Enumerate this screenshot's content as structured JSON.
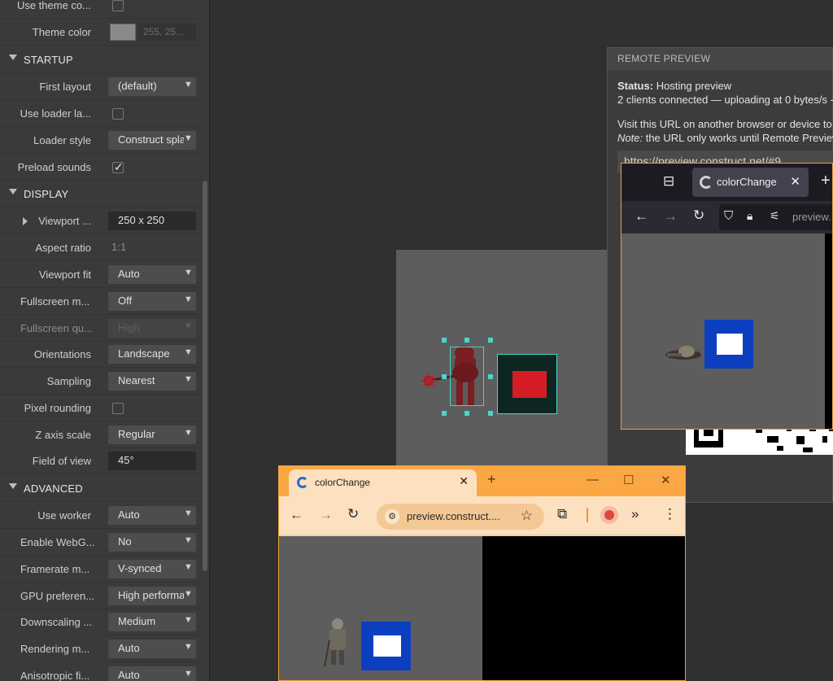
{
  "properties": {
    "rows_top": [
      {
        "label": "Use theme co...",
        "kind": "checkbox",
        "checked": false
      },
      {
        "label": "Theme color",
        "kind": "color",
        "value": "255, 25..."
      }
    ],
    "startup": {
      "title": "STARTUP",
      "first_layout": {
        "label": "First layout",
        "value": "(default)"
      },
      "use_loader": {
        "label": "Use loader la...",
        "checked": false
      },
      "loader_style": {
        "label": "Loader style",
        "value": "Construct spla"
      },
      "preload_sounds": {
        "label": "Preload sounds",
        "checked": true
      }
    },
    "display": {
      "title": "DISPLAY",
      "viewport_size": {
        "label": "Viewport ...",
        "value": "250 x 250"
      },
      "aspect_ratio": {
        "label": "Aspect ratio",
        "value": "1:1"
      },
      "viewport_fit": {
        "label": "Viewport fit",
        "value": "Auto"
      },
      "fullscreen_mode": {
        "label": "Fullscreen m...",
        "value": "Off"
      },
      "fullscreen_quality": {
        "label": "Fullscreen qu...",
        "value": "High"
      },
      "orientations": {
        "label": "Orientations",
        "value": "Landscape"
      },
      "sampling": {
        "label": "Sampling",
        "value": "Nearest"
      },
      "pixel_rounding": {
        "label": "Pixel rounding",
        "checked": false
      },
      "z_axis_scale": {
        "label": "Z axis scale",
        "value": "Regular"
      },
      "field_of_view": {
        "label": "Field of view",
        "value": "45°"
      }
    },
    "advanced": {
      "title": "ADVANCED",
      "use_worker": {
        "label": "Use worker",
        "value": "Auto"
      },
      "enable_webgpu": {
        "label": "Enable WebG...",
        "value": "No"
      },
      "framerate_mode": {
        "label": "Framerate m...",
        "value": "V-synced"
      },
      "gpu_preference": {
        "label": "GPU preferen...",
        "value": "High performa"
      },
      "downscaling": {
        "label": "Downscaling ...",
        "value": "Medium"
      },
      "rendering_mode": {
        "label": "Rendering m...",
        "value": "Auto"
      },
      "anisotropic": {
        "label": "Anisotropic fi...",
        "value": "Auto"
      }
    }
  },
  "remote_preview": {
    "title": "REMOTE PREVIEW",
    "status_label": "Status:",
    "status_value": "Hosting preview",
    "clients": "2 clients connected — uploading at 0 bytes/s -",
    "visit_text": "Visit this URL on another browser or device to",
    "note_label": "Note:",
    "note_text": "the URL only works until Remote Preview",
    "url": "https://preview.construct.net/#9"
  },
  "firefox": {
    "tab_title": "colorChange",
    "url_text": "preview."
  },
  "chrome": {
    "tab_title": "colorChange",
    "url_text": "preview.construct...."
  },
  "colors": {
    "accent_selection": "#48d6c6",
    "red_sprite": "#d41d24",
    "blue_sprite": "#0b3fbf",
    "firefox_border": "#e8a33d",
    "chrome_tabbar": "#fba743"
  }
}
